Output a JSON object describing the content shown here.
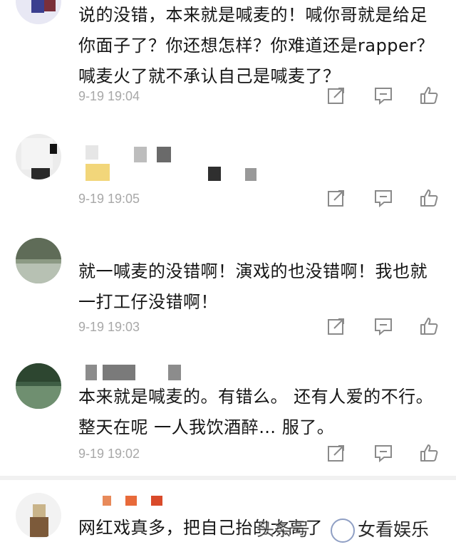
{
  "comments": [
    {
      "text": "说的没错，本来就是喊麦的！喊你哥就是给足你面子了？你还想怎样？你难道还是rapper？喊麦火了就不承认自己是喊麦了？",
      "time": "9-19 19:04"
    },
    {
      "text": "",
      "time": "9-19 19:05"
    },
    {
      "text": "就一喊麦的没错啊！演戏的也没错啊！我也就一打工仔没错啊！",
      "time": "9-19 19:03"
    },
    {
      "text": "本来就是喊麦的。有错么。 还有人爱的不行。整天在呢 一人我饮酒醉… 服了。",
      "time": "9-19 19:02"
    },
    {
      "text": "网红戏真多，把自己抬的太高了",
      "time": ""
    }
  ],
  "actions": {
    "share_icon": "share-icon",
    "reply_icon": "comment-icon",
    "like_icon": "thumbs-up-icon"
  },
  "watermark": {
    "label": "女看娱乐",
    "prefix": "头条号"
  },
  "colors": {
    "text": "#151515",
    "timestamp": "#a8a8a8",
    "icon": "#8a8a8a",
    "divider": "#e9e9e9"
  }
}
